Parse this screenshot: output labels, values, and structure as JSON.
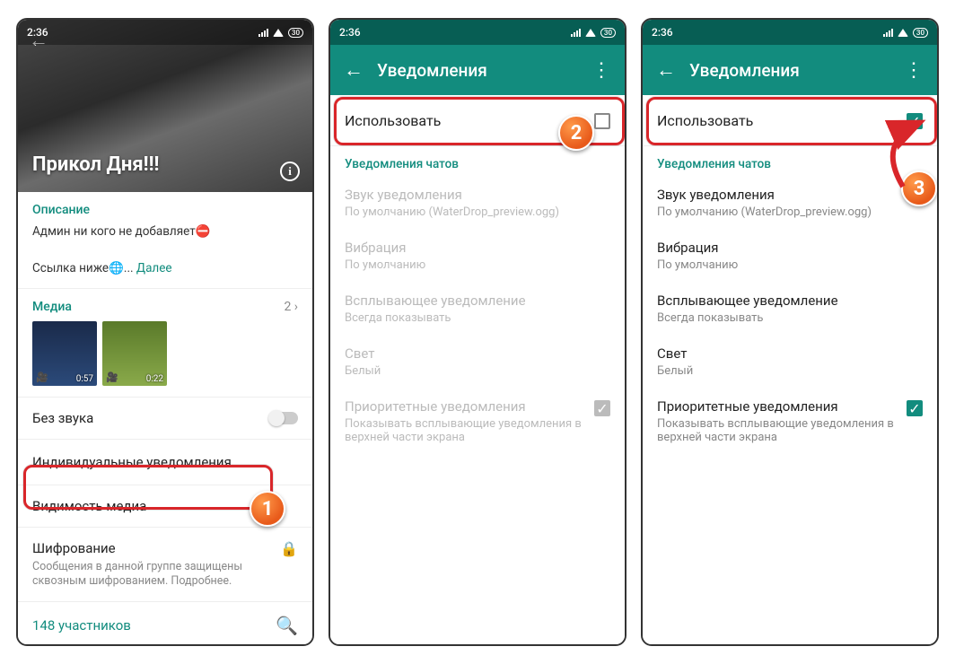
{
  "status": {
    "time": "2:36",
    "battery": "30"
  },
  "screen1": {
    "group_title": "Прикол Дня!!!",
    "desc_heading": "Описание",
    "desc_line1": "Админ ни кого не добавляет⛔",
    "desc_line2": "Ссылка ниже🌐... ",
    "desc_more": "Далее",
    "media_label": "Медиа",
    "media_count": "2 ›",
    "thumb1_dur": "0:57",
    "thumb2_dur": "0:22",
    "mute_label": "Без звука",
    "custom_notif_label": "Индивидуальные уведомления",
    "media_vis_label": "Видимость медиа",
    "encryption_label": "Шифрование",
    "encryption_sub": "Сообщения в данной группе защищены сквозным шифрованием. Подробнее.",
    "participants": "148 участников"
  },
  "notif_header": "Уведомления",
  "notif": {
    "use_label": "Использовать",
    "chats_heading": "Уведомления чатов",
    "sound_title": "Звук уведомления",
    "sound_sub": "По умолчанию (WaterDrop_preview.ogg)",
    "vibration_title": "Вибрация",
    "vibration_sub": "По умолчанию",
    "popup_title": "Всплывающее уведомление",
    "popup_sub": "Всегда показывать",
    "light_title": "Свет",
    "light_sub": "Белый",
    "priority_title": "Приоритетные уведомления",
    "priority_sub": "Показывать всплывающие уведомления в верхней части экрана"
  },
  "badges": {
    "one": "1",
    "two": "2",
    "three": "3"
  }
}
